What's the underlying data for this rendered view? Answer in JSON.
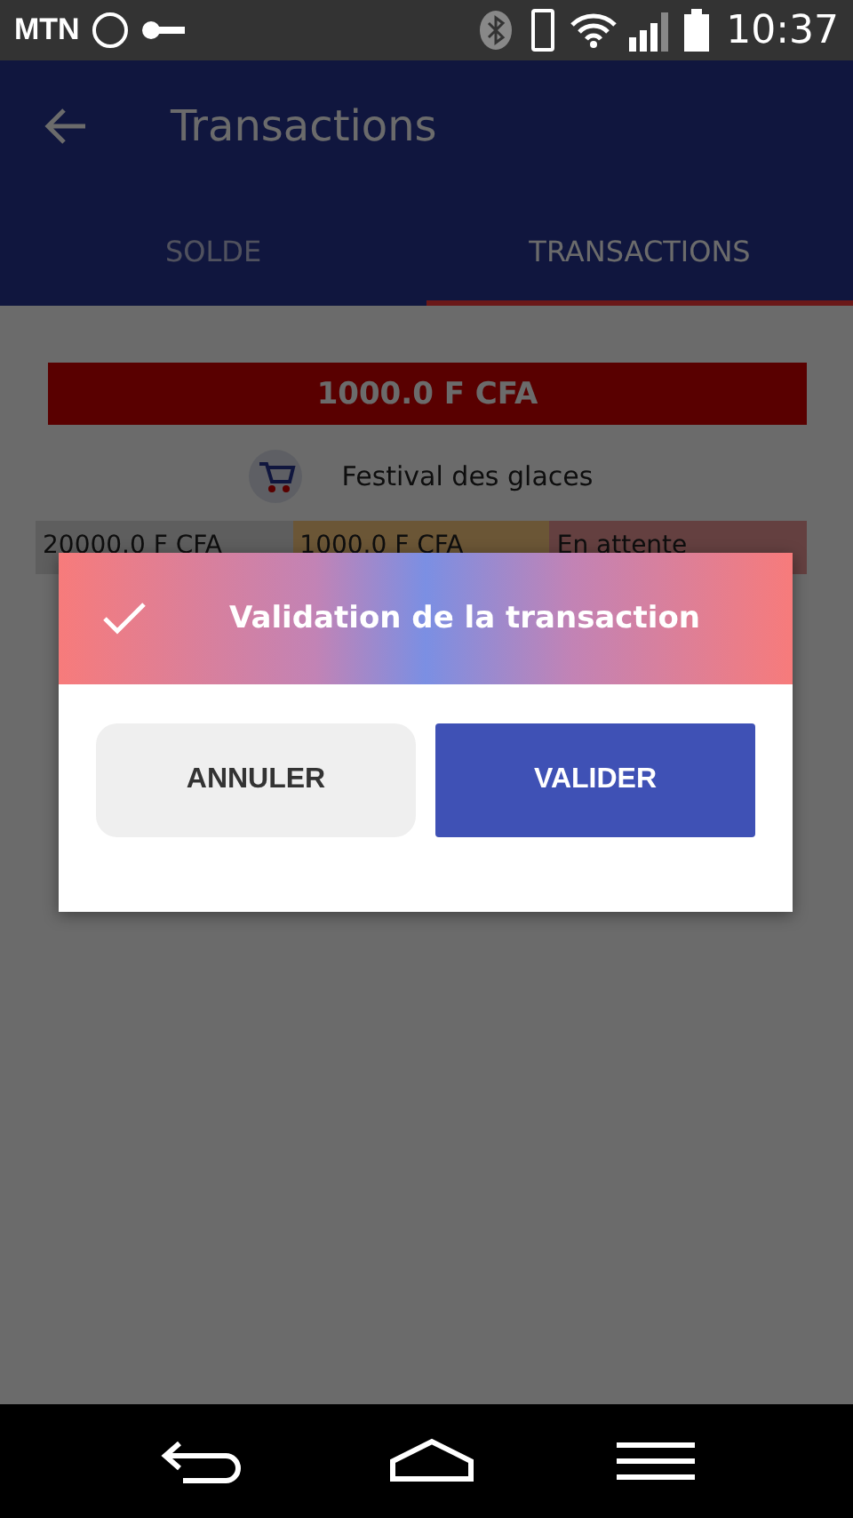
{
  "status_bar": {
    "carrier": "MTN",
    "time": "10:37"
  },
  "app_bar": {
    "title": "Transactions"
  },
  "tabs": [
    {
      "label": "SOLDE",
      "selected": false
    },
    {
      "label": "TRANSACTIONS",
      "selected": true
    }
  ],
  "transaction": {
    "amount": "1000.0 F CFA",
    "merchant": "Festival des glaces",
    "cells": [
      "20000.0 F CFA",
      "1000.0 F CFA",
      "En attente"
    ]
  },
  "dialog": {
    "title": "Validation de la transaction",
    "buttons": [
      {
        "label": "ANNULER",
        "kind": "secondary"
      },
      {
        "label": "VALIDER",
        "kind": "primary"
      }
    ]
  }
}
